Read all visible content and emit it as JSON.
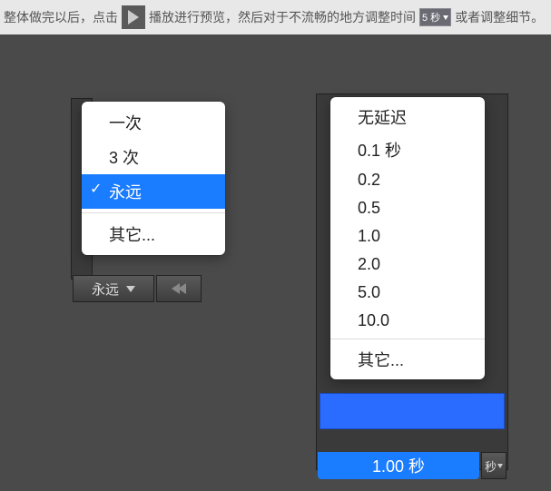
{
  "topbar": {
    "text_before_play": "整体做完以后，点击",
    "text_mid": "播放进行预览，然后对于不流畅的地方调整时间",
    "time_badge_label": "5 秒",
    "text_after": "或者调整细节。"
  },
  "loop_menu": {
    "items": [
      "一次",
      "3 次",
      "永远"
    ],
    "selected_index": 2,
    "other_label": "其它...",
    "button_label": "永远"
  },
  "delay_menu": {
    "items": [
      "无延迟",
      "0.1 秒",
      "0.2",
      "0.5",
      "1.0",
      "2.0",
      "5.0",
      "10.0"
    ],
    "other_label": "其它...",
    "current_display": "1.00 秒",
    "tail_label": "秒"
  }
}
